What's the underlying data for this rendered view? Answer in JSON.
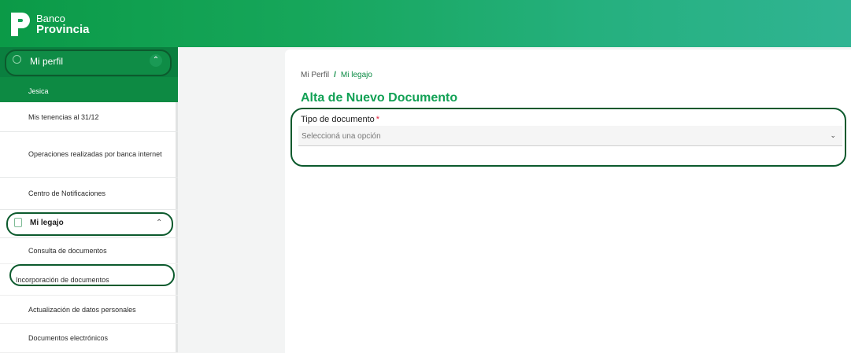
{
  "header": {
    "brand_line1": "Banco",
    "brand_line2": "Provincia",
    "brand_color": "#0b9a47"
  },
  "sidebar": {
    "profile_label": "Mi perfil",
    "user_name": "Jesica",
    "items": [
      "Mis tenencias al 31/12",
      "Operaciones realizadas por banca internet",
      "Centro de Notificaciones"
    ],
    "legajo_label": "Mi legajo",
    "legajo_items": [
      "Consulta de documentos",
      "Incorporación de documentos",
      "Actualización de datos personales",
      "Documentos electrónicos"
    ]
  },
  "main": {
    "breadcrumb_root": "Mi Perfil",
    "breadcrumb_sep": "/",
    "breadcrumb_current": "Mi legajo",
    "title": "Alta de Nuevo Documento",
    "field_label": "Tipo de documento",
    "required_mark": "*",
    "select_placeholder": "Seleccioná una opción"
  }
}
